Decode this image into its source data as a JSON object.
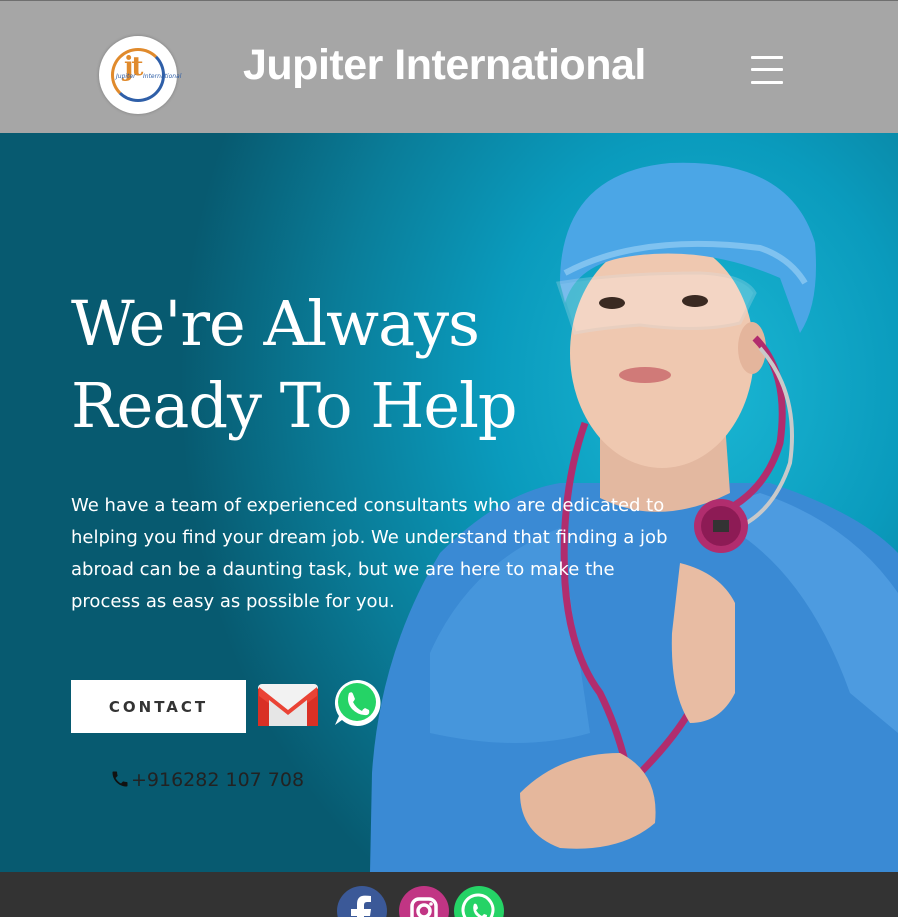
{
  "header": {
    "site_title": "Jupiter International",
    "logo_letters": "jt",
    "logo_small_left": "Jupiter",
    "logo_small_right": "International",
    "menu_icon": "hamburger-menu-icon"
  },
  "hero": {
    "title_line1": "We're Always",
    "title_line2": "Ready To Help",
    "description": "We have a team of experienced consultants who are dedicated to helping you find your dream job. We understand that finding a job abroad can be a daunting task, but we are here to make the process as easy as possible for you.",
    "contact_label": "CONTACT",
    "phone": "+916282 107 708",
    "icons": [
      "gmail-icon",
      "whatsapp-icon",
      "phone-icon"
    ]
  },
  "footer": {
    "social_icons": [
      "facebook-icon",
      "instagram-icon",
      "whatsapp-icon"
    ]
  },
  "colors": {
    "header_bg": "#a6a6a6",
    "hero_teal": "#0a9bbd",
    "footer_bg": "#333333",
    "logo_orange": "#e08a2c",
    "logo_blue": "#2f5fa8"
  }
}
